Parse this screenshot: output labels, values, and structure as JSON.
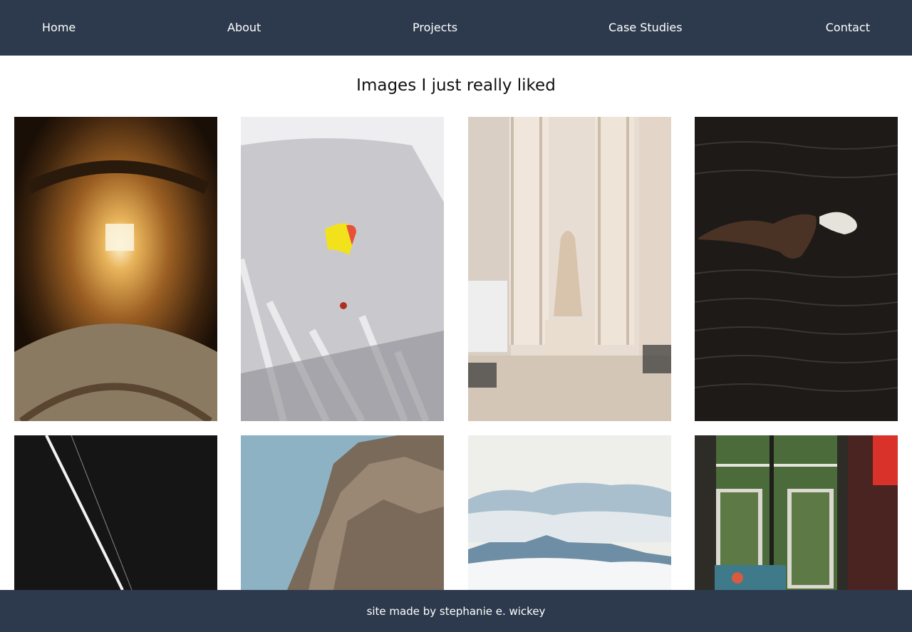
{
  "nav": {
    "home": "Home",
    "about": "About",
    "projects": "Projects",
    "case_studies": "Case Studies",
    "contact": "Contact"
  },
  "page": {
    "title": "Images I just really liked"
  },
  "gallery": {
    "photos": [
      {
        "subject": "ornate dome skylight"
      },
      {
        "subject": "paraglider over mountain"
      },
      {
        "subject": "classical columns with statue"
      },
      {
        "subject": "whale in dark water"
      },
      {
        "subject": "light streak on black"
      },
      {
        "subject": "rocky cliff"
      },
      {
        "subject": "misty mountains"
      },
      {
        "subject": "window with stained glass"
      }
    ]
  },
  "footer": {
    "text": "site made by stephanie e. wickey"
  },
  "colors": {
    "nav_background": "#2d3a4d",
    "nav_text": "#ffffff",
    "page_background": "#ffffff"
  }
}
